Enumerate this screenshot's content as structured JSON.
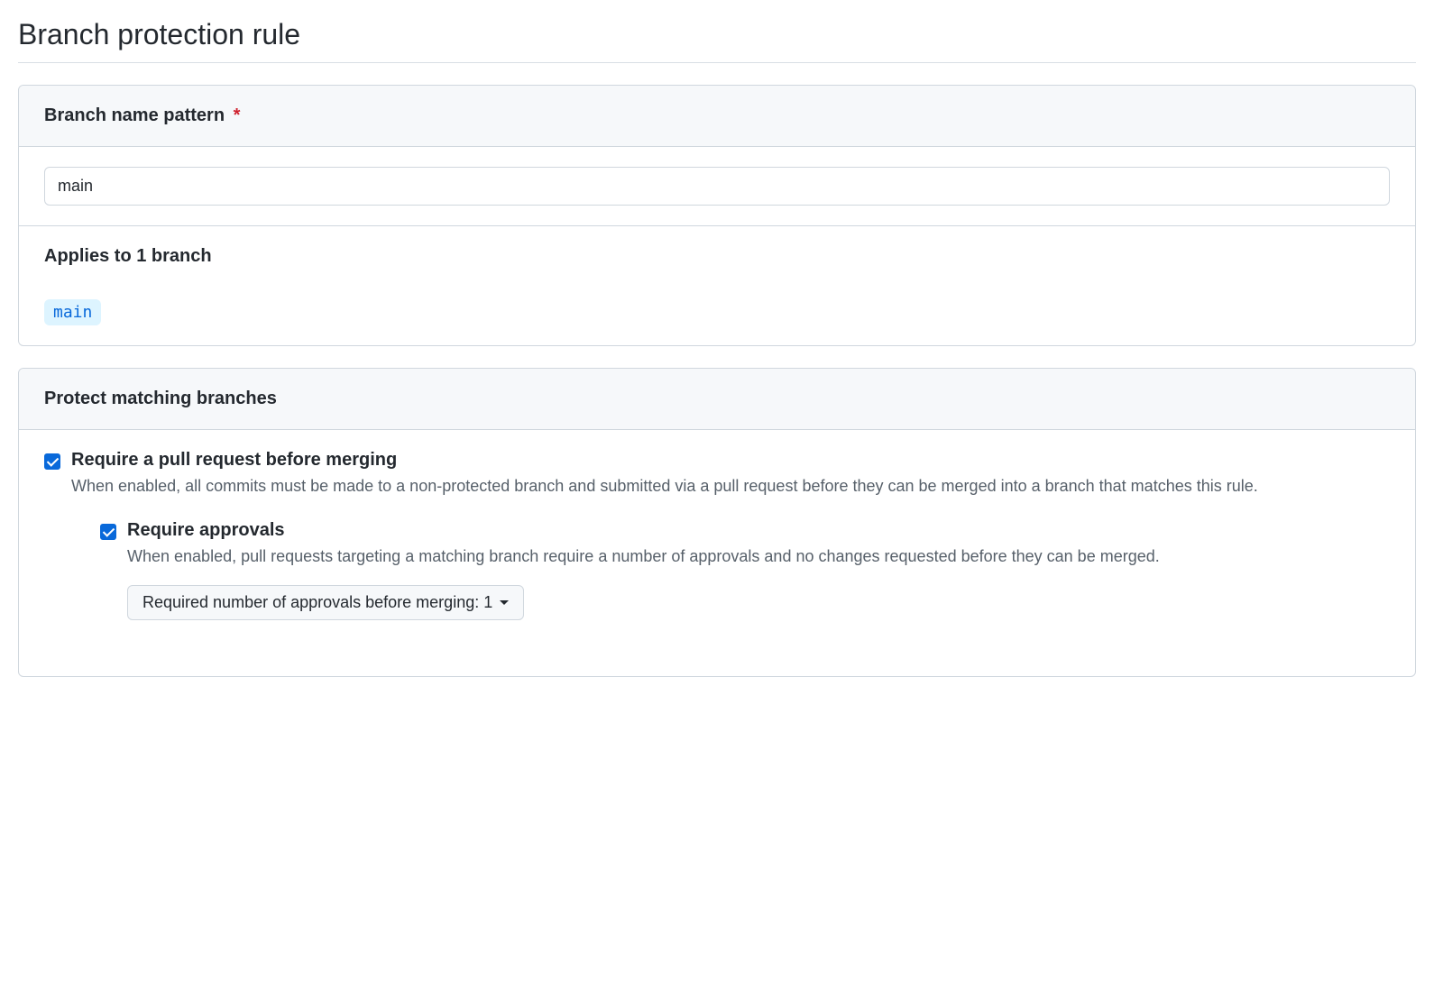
{
  "page": {
    "title": "Branch protection rule"
  },
  "pattern": {
    "label": "Branch name pattern",
    "required_marker": "*",
    "value": "main"
  },
  "applies": {
    "title": "Applies to 1 branch",
    "branches": [
      "main"
    ]
  },
  "protect": {
    "title": "Protect matching branches",
    "rules": [
      {
        "id": "require-pr",
        "title": "Require a pull request before merging",
        "description": "When enabled, all commits must be made to a non-protected branch and submitted via a pull request before they can be merged into a branch that matches this rule.",
        "checked": true,
        "children": [
          {
            "id": "require-approvals",
            "title": "Require approvals",
            "description": "When enabled, pull requests targeting a matching branch require a number of approvals and no changes requested before they can be merged.",
            "checked": true,
            "select": {
              "label": "Required number of approvals before merging: 1"
            }
          }
        ]
      }
    ]
  }
}
